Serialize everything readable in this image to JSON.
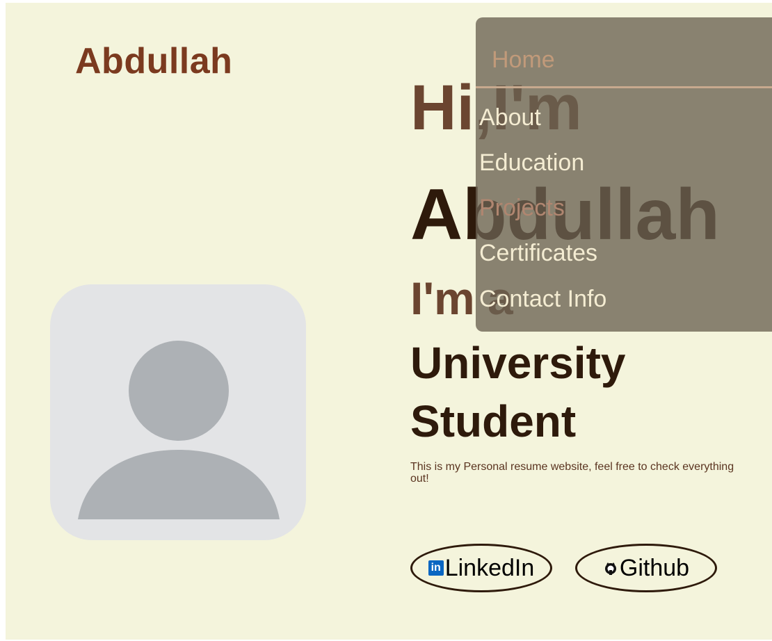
{
  "header": {
    "logo": "Abdullah"
  },
  "nav": {
    "home": "Home",
    "items": [
      "About",
      "Education",
      "Projects",
      "Certificates",
      "Contact Info"
    ]
  },
  "hero": {
    "greeting": "Hi,I'm",
    "name": "Abdullah",
    "prefix": "I'm a",
    "role": "University Student",
    "description": "This is my Personal resume website, feel free to check everything out!"
  },
  "social": {
    "linkedin_label": "LinkedIn",
    "linkedin_icon_text": "in",
    "github_label": "Github"
  },
  "icons": {
    "avatar": "user-placeholder-icon",
    "linkedin": "linkedin-icon",
    "github": "github-icon"
  },
  "colors": {
    "background": "#f4f4dc",
    "accent": "#7b3a1f",
    "text_dark": "#2e1a0b",
    "nav_overlay": "#6a6252",
    "linkedin_brand": "#0a66c2"
  }
}
